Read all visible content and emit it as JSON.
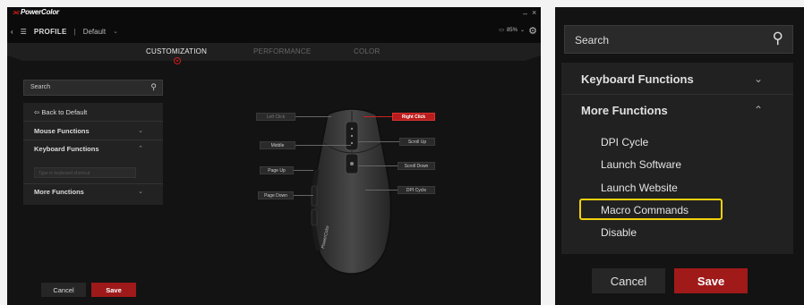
{
  "app": {
    "brand": "PowerColor",
    "page_title": "PROFILE",
    "separator": "|",
    "profile": "Default",
    "battery": "85%",
    "min_glyph": "–",
    "close_glyph": "×"
  },
  "tabs": [
    {
      "label": "CUSTOMIZATION",
      "active": true
    },
    {
      "label": "PERFORMANCE",
      "active": false
    },
    {
      "label": "COLOR",
      "active": false
    }
  ],
  "sidebar": {
    "search_placeholder": "Search",
    "back_label": "Back to Default",
    "mouse_functions": "Mouse Functions",
    "keyboard_functions": "Keyboard Functions",
    "keyboard_input_placeholder": "Type in keyboard shortcut",
    "more_functions": "More Functions"
  },
  "buttons": {
    "cancel": "Cancel",
    "save": "Save"
  },
  "mouse_buttons": {
    "left_click": "Left Click",
    "right_click": "Right Click",
    "middle": "Middle",
    "scroll_up": "Scroll Up",
    "page_up": "Page Up",
    "scroll_down": "Scroll Down",
    "page_down": "Page Down",
    "dpi_cycle": "DPI Cycle",
    "logo_text": "PowerColor"
  },
  "zoom": {
    "search_placeholder": "Search",
    "keyboard_functions": "Keyboard Functions",
    "more_functions": "More Functions",
    "items": [
      "DPI Cycle",
      "Launch Software",
      "Launch Website",
      "Macro Commands",
      "Disable"
    ],
    "cancel": "Cancel",
    "save": "Save"
  },
  "colors": {
    "accent": "#b81c1c",
    "highlight": "#f1d10d",
    "background": "#131313"
  }
}
